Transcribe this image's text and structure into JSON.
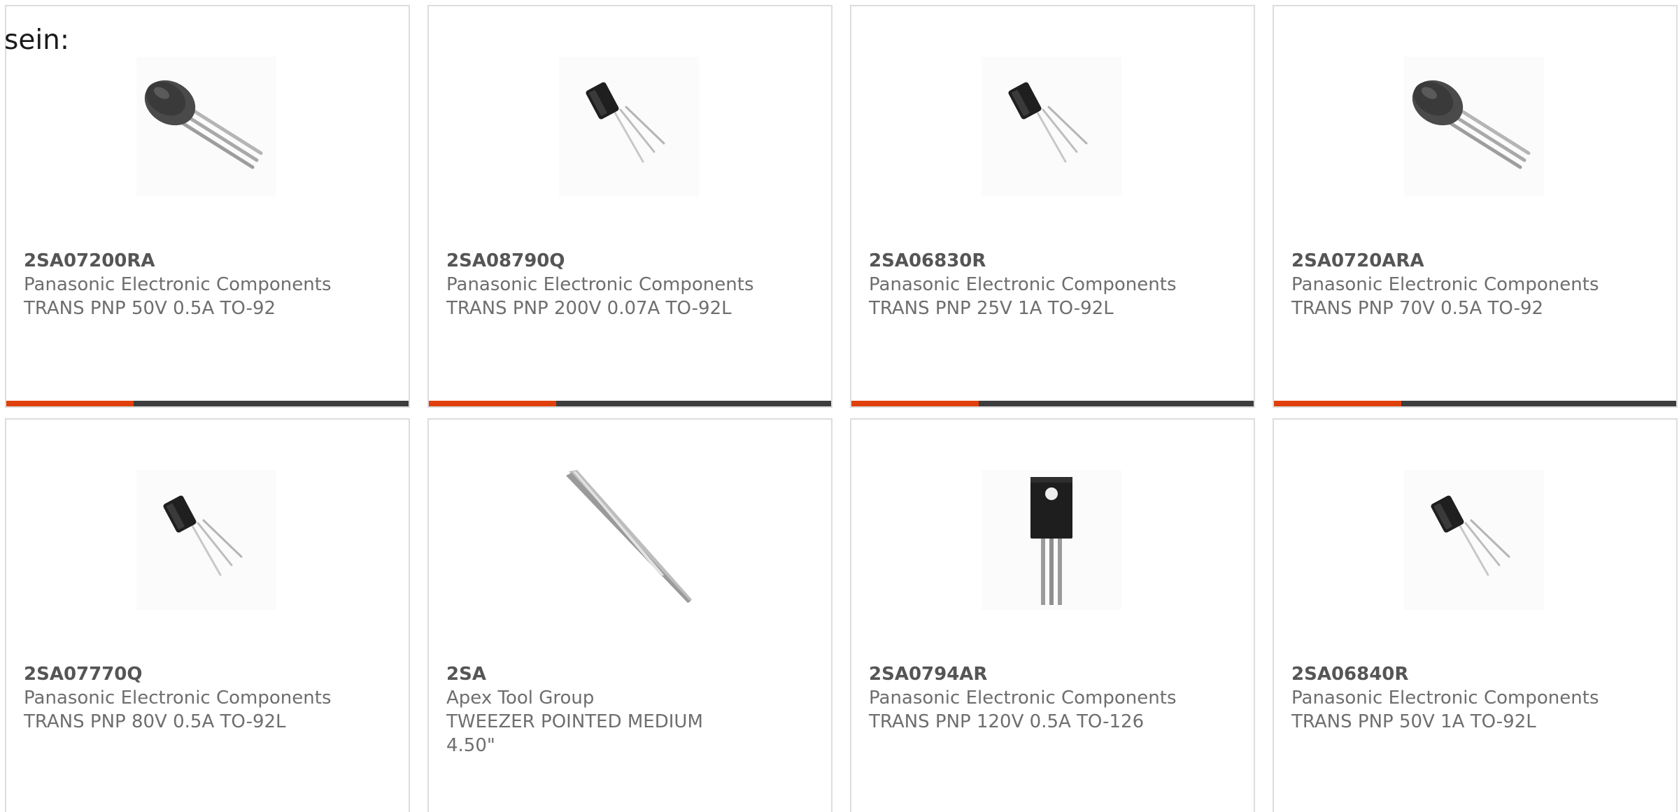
{
  "intro_text": "sein:",
  "colors": {
    "accent": "#e0400b",
    "bar": "#3d3d3d",
    "border": "#dddddd"
  },
  "products": [
    {
      "part": "2SA07200RA",
      "manufacturer": "Panasonic Electronic Components",
      "description": "TRANS PNP 50V 0.5A TO-92",
      "image_icon": "to92-transistor-icon"
    },
    {
      "part": "2SA08790Q",
      "manufacturer": "Panasonic Electronic Components",
      "description": "TRANS PNP 200V 0.07A TO-92L",
      "image_icon": "to92l-transistor-icon"
    },
    {
      "part": "2SA06830R",
      "manufacturer": "Panasonic Electronic Components",
      "description": "TRANS PNP 25V 1A TO-92L",
      "image_icon": "to92l-transistor-icon"
    },
    {
      "part": "2SA0720ARA",
      "manufacturer": "Panasonic Electronic Components",
      "description": "TRANS PNP 70V 0.5A TO-92",
      "image_icon": "to92-transistor-icon"
    },
    {
      "part": "2SA07770Q",
      "manufacturer": "Panasonic Electronic Components",
      "description": "TRANS PNP 80V 0.5A TO-92L",
      "image_icon": "to92l-transistor-icon"
    },
    {
      "part": "2SA",
      "manufacturer": "Apex Tool Group",
      "description": "TWEEZER POINTED MEDIUM 4.50\"",
      "image_icon": "tweezer-icon"
    },
    {
      "part": "2SA0794AR",
      "manufacturer": "Panasonic Electronic Components",
      "description": "TRANS PNP 120V 0.5A TO-126",
      "image_icon": "to126-transistor-icon"
    },
    {
      "part": "2SA06840R",
      "manufacturer": "Panasonic Electronic Components",
      "description": "TRANS PNP 50V 1A TO-92L",
      "image_icon": "to92l-transistor-icon"
    }
  ]
}
